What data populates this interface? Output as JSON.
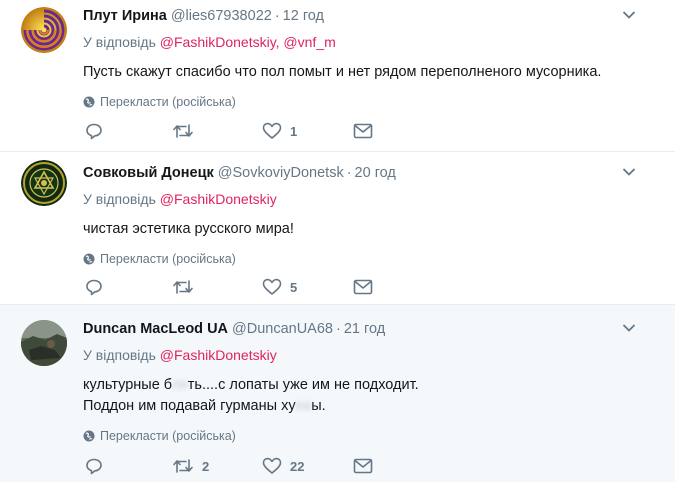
{
  "reply_prefix": "У відповідь",
  "translate_label": "Перекласти (російська)",
  "colors": {
    "link": "#e0245e",
    "muted": "#657786",
    "text": "#14171a",
    "highlight_bg": "#f5f8fa"
  },
  "tweets": [
    {
      "name": "Плут Ирина",
      "handle": "@lies67938022",
      "time": "12 год",
      "reply_to": "@FashikDonetskiy, @vnf_m",
      "text_lines": [
        "Пусть скажут спасибо что пол помыт и нет рядом переполненого мусорника."
      ],
      "replies": "",
      "retweets": "",
      "likes": "1"
    },
    {
      "name": "Совковый Донецк",
      "handle": "@SovkoviyDonetsk",
      "time": "20 год",
      "reply_to": "@FashikDonetskiy",
      "text_lines": [
        "чистая эстетика русского мира!"
      ],
      "replies": "",
      "retweets": "",
      "likes": "5"
    },
    {
      "name": "Duncan MacLeod UA",
      "handle": "@DuncanUA68",
      "time": "21 год",
      "reply_to": "@FashikDonetskiy",
      "text_lines": [
        "культурные б",
        "ть....с лопаты уже им не подходит.",
        "Поддон им подавай гурманы ху",
        "ы."
      ],
      "censored": [
        "ля",
        "ев"
      ],
      "replies": "",
      "retweets": "2",
      "likes": "22"
    }
  ]
}
